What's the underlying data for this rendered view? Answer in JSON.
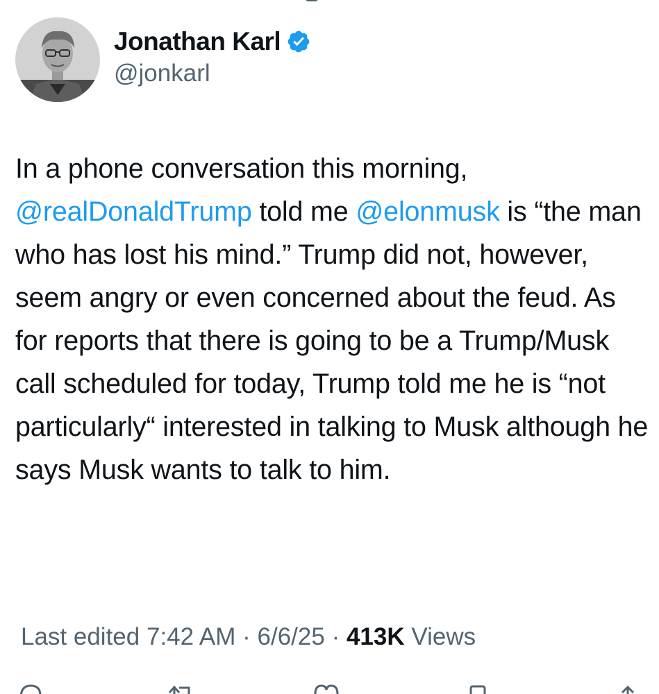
{
  "author": {
    "name": "Jonathan Karl",
    "handle": "@jonkarl",
    "verified": true
  },
  "tweet": {
    "segments": [
      {
        "text": "In a phone conversation this morning, ",
        "type": "text"
      },
      {
        "text": "@realDonaldTrump",
        "type": "mention"
      },
      {
        "text": " told me ",
        "type": "text"
      },
      {
        "text": "@elonmusk",
        "type": "mention"
      },
      {
        "text": " is “the man who has lost his mind.” Trump did not, however, seem angry or even concerned about the feud. As for reports that there is going to be a Trump/Musk call scheduled for today, Trump told me he is “not particularly“ interested in talking to Musk although he says Musk wants to talk to him.",
        "type": "text"
      }
    ]
  },
  "meta": {
    "edited_label": "Last edited",
    "time": "7:42 AM",
    "separator": "·",
    "date": "6/6/25",
    "views_count": "413K",
    "views_label": "Views"
  },
  "colors": {
    "text": "#0f1419",
    "secondary": "#536471",
    "accent": "#1d9bf0"
  },
  "icons": {
    "verified": "verified-badge-icon",
    "actions": [
      "reply-icon",
      "repost-icon",
      "like-icon",
      "bookmark-icon",
      "share-icon"
    ]
  }
}
